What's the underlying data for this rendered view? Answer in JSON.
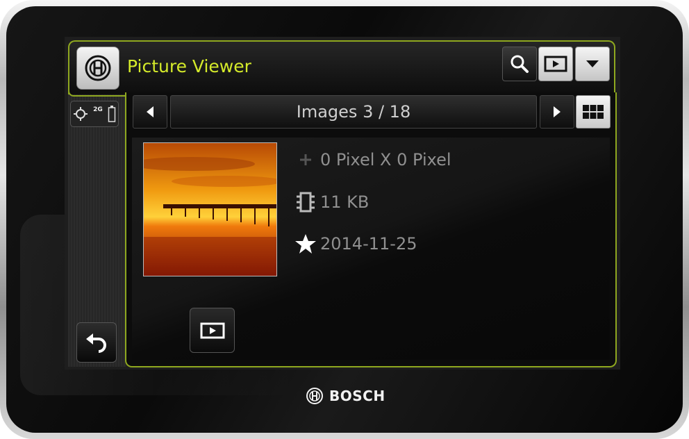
{
  "app": {
    "title": "Picture Viewer"
  },
  "header": {
    "icons": [
      "bosch-logo-icon",
      "search-icon",
      "slideshow-icon",
      "dropdown-icon"
    ]
  },
  "status": {
    "network": "2G"
  },
  "navigation": {
    "title": "Images 3 / 18"
  },
  "image_info": {
    "dimensions": "0 Pixel X 0 Pixel",
    "file_size": "11 KB",
    "date": "2014-11-25"
  },
  "device": {
    "brand": "BOSCH"
  },
  "colors": {
    "accent": "#d4ea2a",
    "frame": "#8fa81f"
  }
}
